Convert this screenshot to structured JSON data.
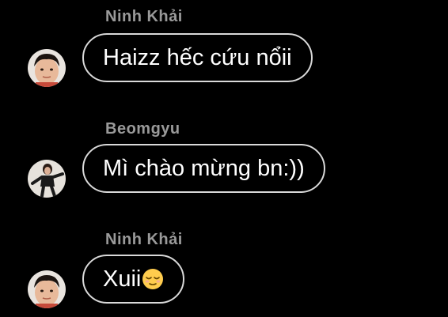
{
  "messages": [
    {
      "sender": "Ninh  Khải",
      "text": "Haizz hếc cứu nổii",
      "avatar": "boy-avatar"
    },
    {
      "sender": "Beomgyu",
      "text": "Mì chào mừng bn:))",
      "avatar": "dancer-avatar"
    },
    {
      "sender": "Ninh  Khải",
      "text": "Xuii",
      "emoji": "relieved-face-emoji",
      "avatar": "boy-avatar"
    }
  ],
  "colors": {
    "background": "#000000",
    "bubble_border": "#d9d9d9",
    "sender_name": "#9a9a9a",
    "text": "#ffffff"
  }
}
